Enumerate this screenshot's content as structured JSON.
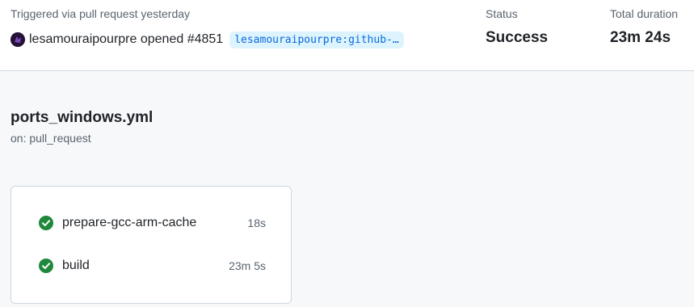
{
  "summary": {
    "trigger_text": "Triggered via pull request yesterday",
    "actor": "lesamouraipourpre opened #4851",
    "branch": "lesamouraipourpre:github-…",
    "status_label": "Status",
    "status_value": "Success",
    "duration_label": "Total duration",
    "duration_value": "23m 24s"
  },
  "workflow": {
    "name": "ports_windows.yml",
    "trigger": "on: pull_request"
  },
  "jobs": [
    {
      "name": "prepare-gcc-arm-cache",
      "duration": "18s",
      "status_icon": "check-circle-icon"
    },
    {
      "name": "build",
      "duration": "23m 5s",
      "status_icon": "check-circle-icon"
    }
  ],
  "colors": {
    "success": "#1f883d",
    "link": "#0969da",
    "muted": "#59636e",
    "border": "#d0d7de"
  }
}
